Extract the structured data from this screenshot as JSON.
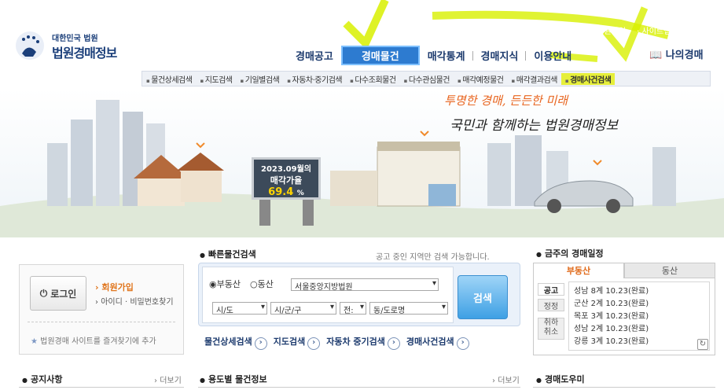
{
  "header": {
    "logo_sub": "대한민국 법원",
    "logo_main": "법원경매정보",
    "util_links": [
      "로그인",
      "회원가입",
      "사이트맵"
    ],
    "nav": [
      "경매공고",
      "경매물건",
      "매각통계",
      "경매지식",
      "이용안내"
    ],
    "my_auction": "나의경매",
    "sub_nav": [
      "물건상세검색",
      "지도검색",
      "기일별검색",
      "자동차·중기검색",
      "다수조회물건",
      "다수관심물건",
      "매각예정물건",
      "매각결과검색",
      "경매사건검색"
    ]
  },
  "hero": {
    "slogan1": "투명한 경매, 든든한 미래",
    "slogan2": "국민과 함께하는 법원경매정보",
    "billboard_month": "2023.09월의",
    "billboard_label": "매각가율",
    "billboard_value": "69.4",
    "billboard_unit": "%"
  },
  "login": {
    "button": "로그인",
    "join": "회원가입",
    "find": "아이디 · 비밀번호찾기",
    "favorite": "법원경매 사이트를 즐겨찾기에 추가"
  },
  "quick_search": {
    "title": "빠른물건검색",
    "note": "공고 중인 지역만 검색 가능합니다.",
    "radio_realty": "부동산",
    "radio_movable": "동산",
    "court": "서울중앙지방법원",
    "sel_sido": "시/도",
    "sel_sigungu": "시/군/구",
    "sel_jeon": "전:",
    "sel_dong": "동/도로명",
    "search_button": "검색",
    "links": [
      "물건상세검색",
      "지도검색",
      "자동차 중기검색",
      "경매사건검색"
    ]
  },
  "schedule": {
    "title": "금주의 경매일정",
    "tab_realty": "부동산",
    "tab_movable": "동산",
    "side_tabs": [
      "공고",
      "정정",
      "취하\n취소"
    ],
    "items": [
      "성남 8계 10.23(완료)",
      "군산 2계 10.23(완료)",
      "목포 3계 10.23(완료)",
      "성남 2계 10.23(완료)",
      "강릉 3계 10.23(완료)"
    ]
  },
  "notice": {
    "title": "공지사항",
    "more": "더보기"
  },
  "usage": {
    "title": "용도별 물건정보",
    "more": "더보기"
  },
  "help": {
    "title": "경매도우미"
  }
}
